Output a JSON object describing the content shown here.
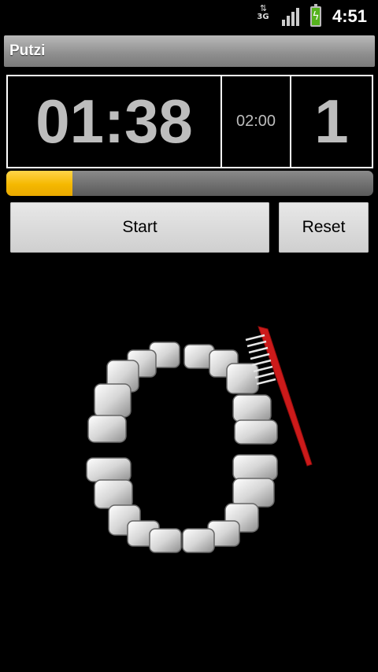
{
  "status_bar": {
    "network_label": "3G",
    "network_icon": "data-3g-icon",
    "signal_icon": "signal-strength-icon",
    "battery_icon": "battery-charging-icon",
    "time": "4:51"
  },
  "app": {
    "title": "Putzi"
  },
  "timer": {
    "elapsed": "01:38",
    "total": "02:00",
    "count": "1"
  },
  "progress": {
    "fraction": 0.18,
    "color": "#f5b800"
  },
  "buttons": {
    "start": "Start",
    "reset": "Reset"
  },
  "illustration": {
    "icon": "teeth-toothbrush-illustration",
    "brush_color": "#cc1a1a"
  }
}
